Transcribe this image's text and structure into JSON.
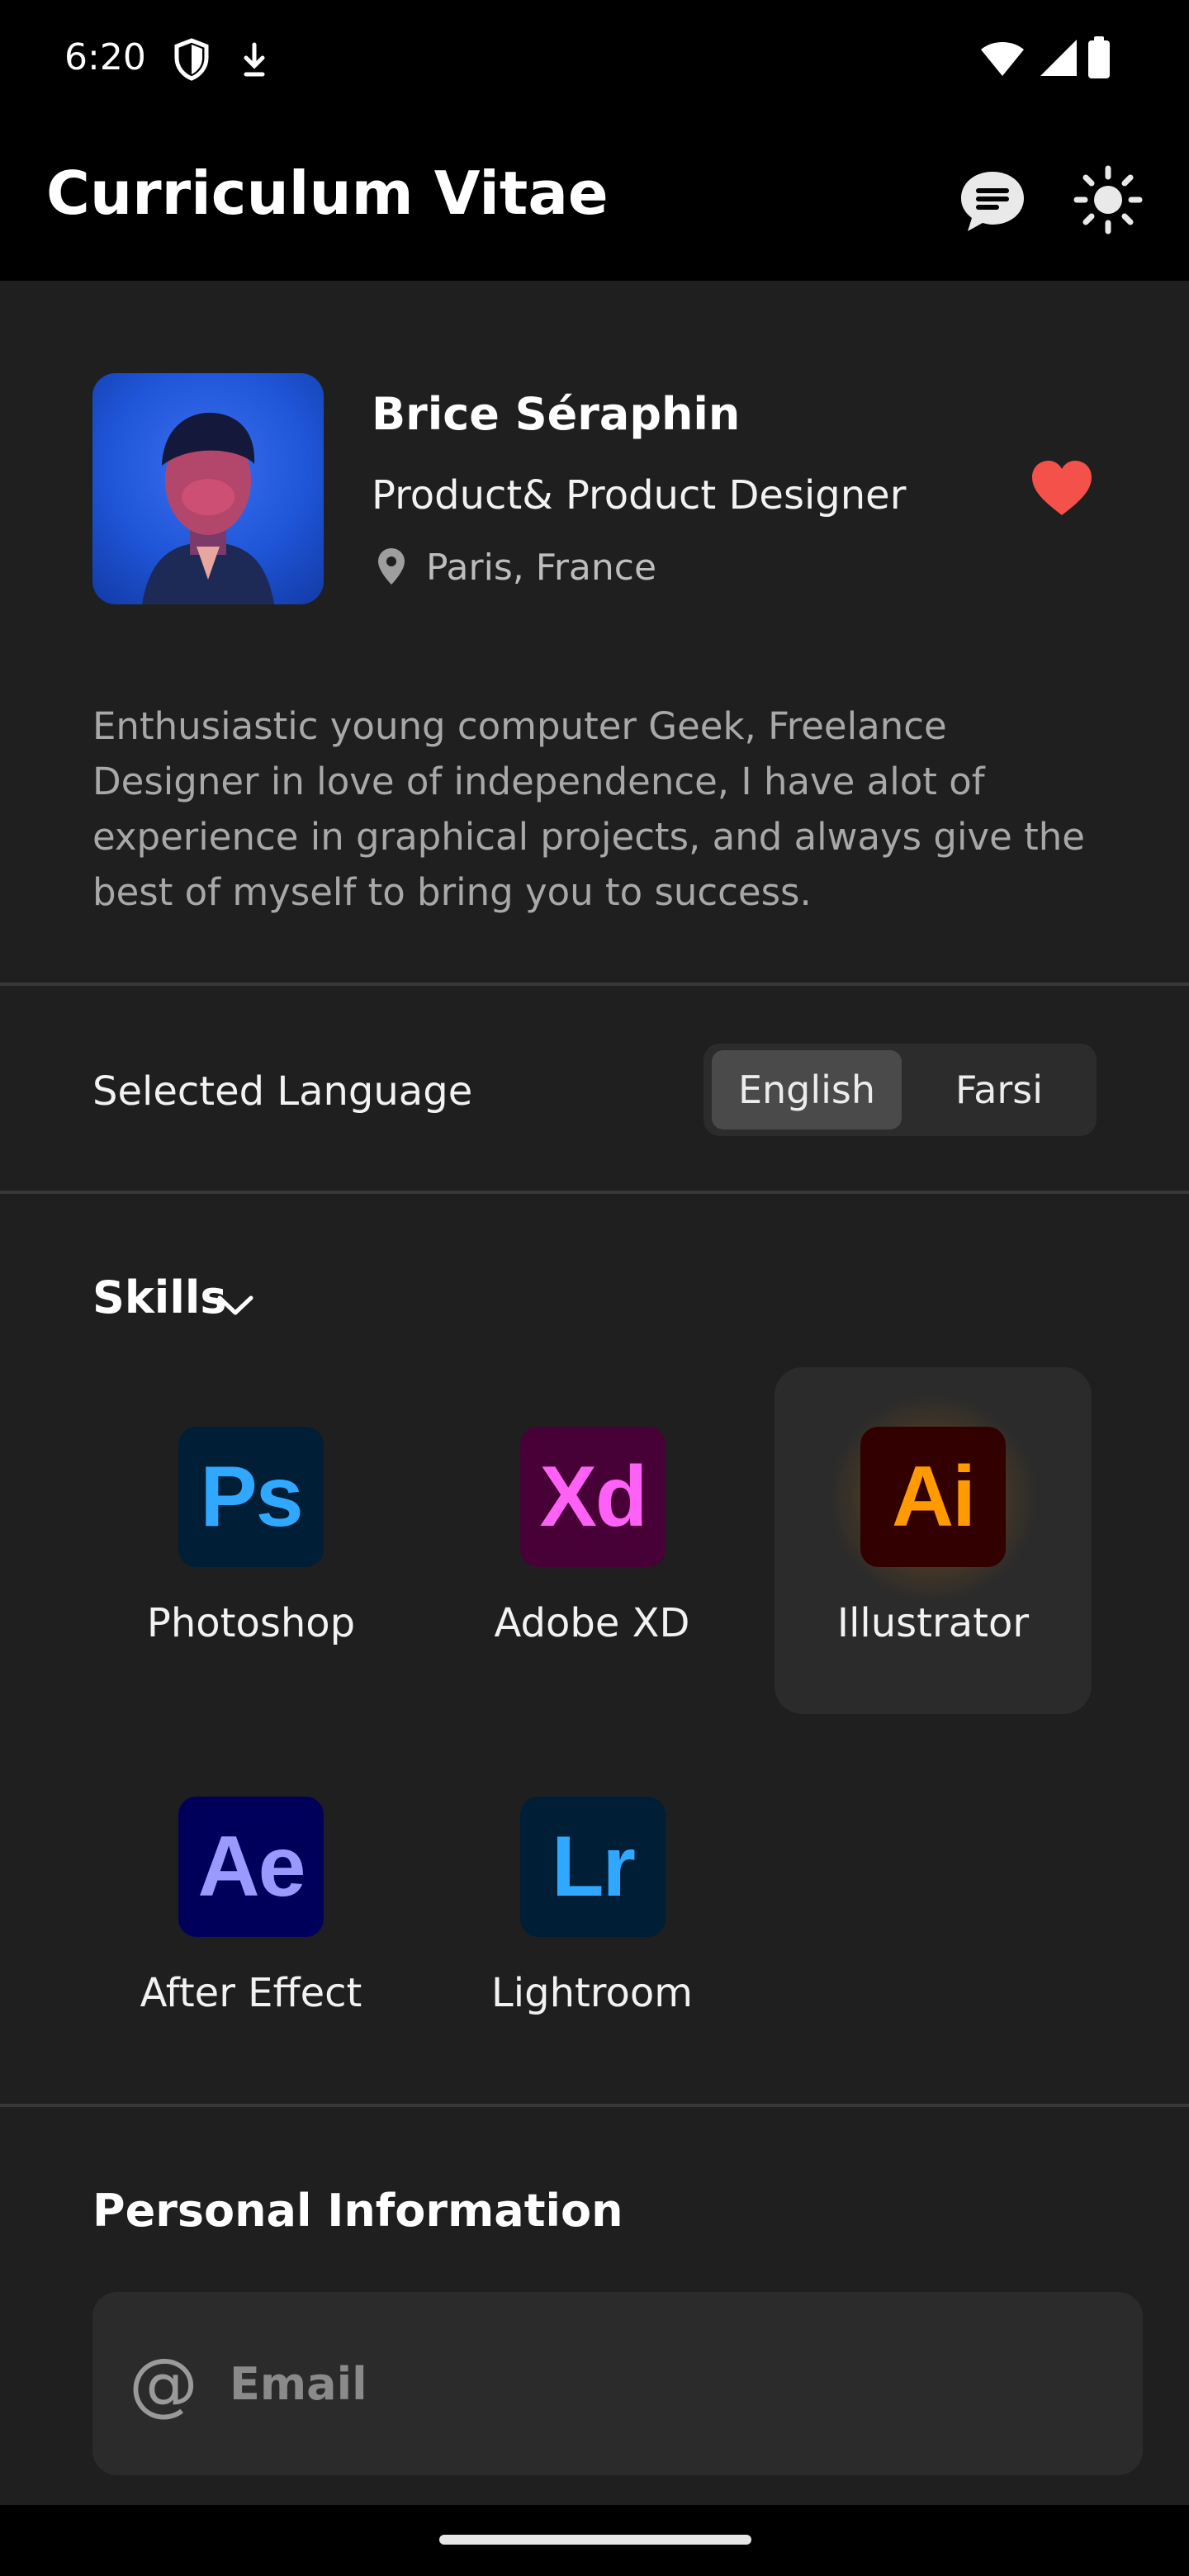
{
  "status_bar": {
    "time": "6:20"
  },
  "app_bar": {
    "title": "Curriculum Vitae"
  },
  "profile": {
    "name": "Brice Séraphin",
    "job_title": "Product& Product Designer",
    "location": "Paris, France",
    "favorite": true
  },
  "bio": "Enthusiastic young computer Geek, Freelance Designer in love of independence, I have alot of experience in graphical projects, and always give the best of myself to bring you to success.",
  "language": {
    "label": "Selected Language",
    "options": [
      "English",
      "Farsi"
    ],
    "selected": "English"
  },
  "skills": {
    "title": "Skills",
    "items": [
      {
        "abbr": "Ps",
        "label": "Photoshop",
        "bg": "#001e36",
        "fg": "#31a8ff"
      },
      {
        "abbr": "Xd",
        "label": "Adobe XD",
        "bg": "#470137",
        "fg": "#ff61f6"
      },
      {
        "abbr": "Ai",
        "label": "Illustrator",
        "bg": "#330000",
        "fg": "#ff9a00",
        "selected": true
      },
      {
        "abbr": "Ae",
        "label": "After Effect",
        "bg": "#00005b",
        "fg": "#9999ff"
      },
      {
        "abbr": "Lr",
        "label": "Lightroom",
        "bg": "#001e36",
        "fg": "#31a8ff"
      }
    ]
  },
  "personal_info": {
    "title": "Personal Information",
    "email_placeholder": "Email"
  },
  "colors": {
    "background": "#1f1f1f",
    "bar": "#000000",
    "heart": "#f4514a"
  }
}
